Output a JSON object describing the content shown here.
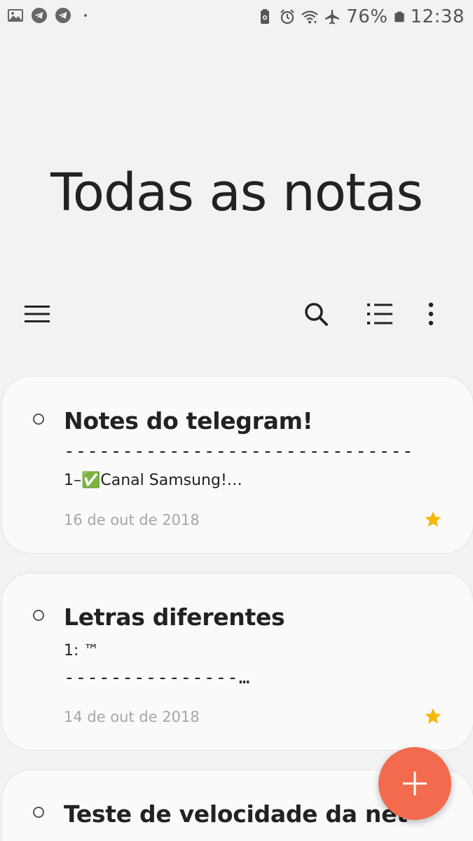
{
  "status_bar": {
    "battery_percent": "76%",
    "time": "12:38",
    "left_icons": [
      "gallery-icon",
      "telegram-icon",
      "telegram-icon",
      "dot"
    ],
    "right_icons": [
      "battery-saver-icon",
      "alarm-icon",
      "wifi-icon",
      "airplane-mode-icon",
      "battery-icon"
    ]
  },
  "header": {
    "title": "Todas as notas"
  },
  "toolbar": {
    "icons": [
      "menu-icon",
      "search-icon",
      "list-view-icon",
      "more-options-icon"
    ]
  },
  "notes": [
    {
      "title": "Notes do telegram!",
      "preview_line1": "------------------------------",
      "preview_line2": "1–✅Canal Samsung!…",
      "date": "16 de out de 2018",
      "starred": true
    },
    {
      "title": "Letras diferentes",
      "preview_line1": "1:  ™",
      "preview_line2": "---------------…",
      "date": "14 de out de 2018",
      "starred": true
    },
    {
      "title": "Teste de velocidade da net",
      "preview_line1": "",
      "preview_line2": "",
      "date": "",
      "starred": false
    }
  ],
  "colors": {
    "background": "#f2f2f2",
    "card": "#fafafa",
    "fab": "#f26b4f",
    "star": "#f5b800",
    "date_text": "#a6a6a6"
  }
}
